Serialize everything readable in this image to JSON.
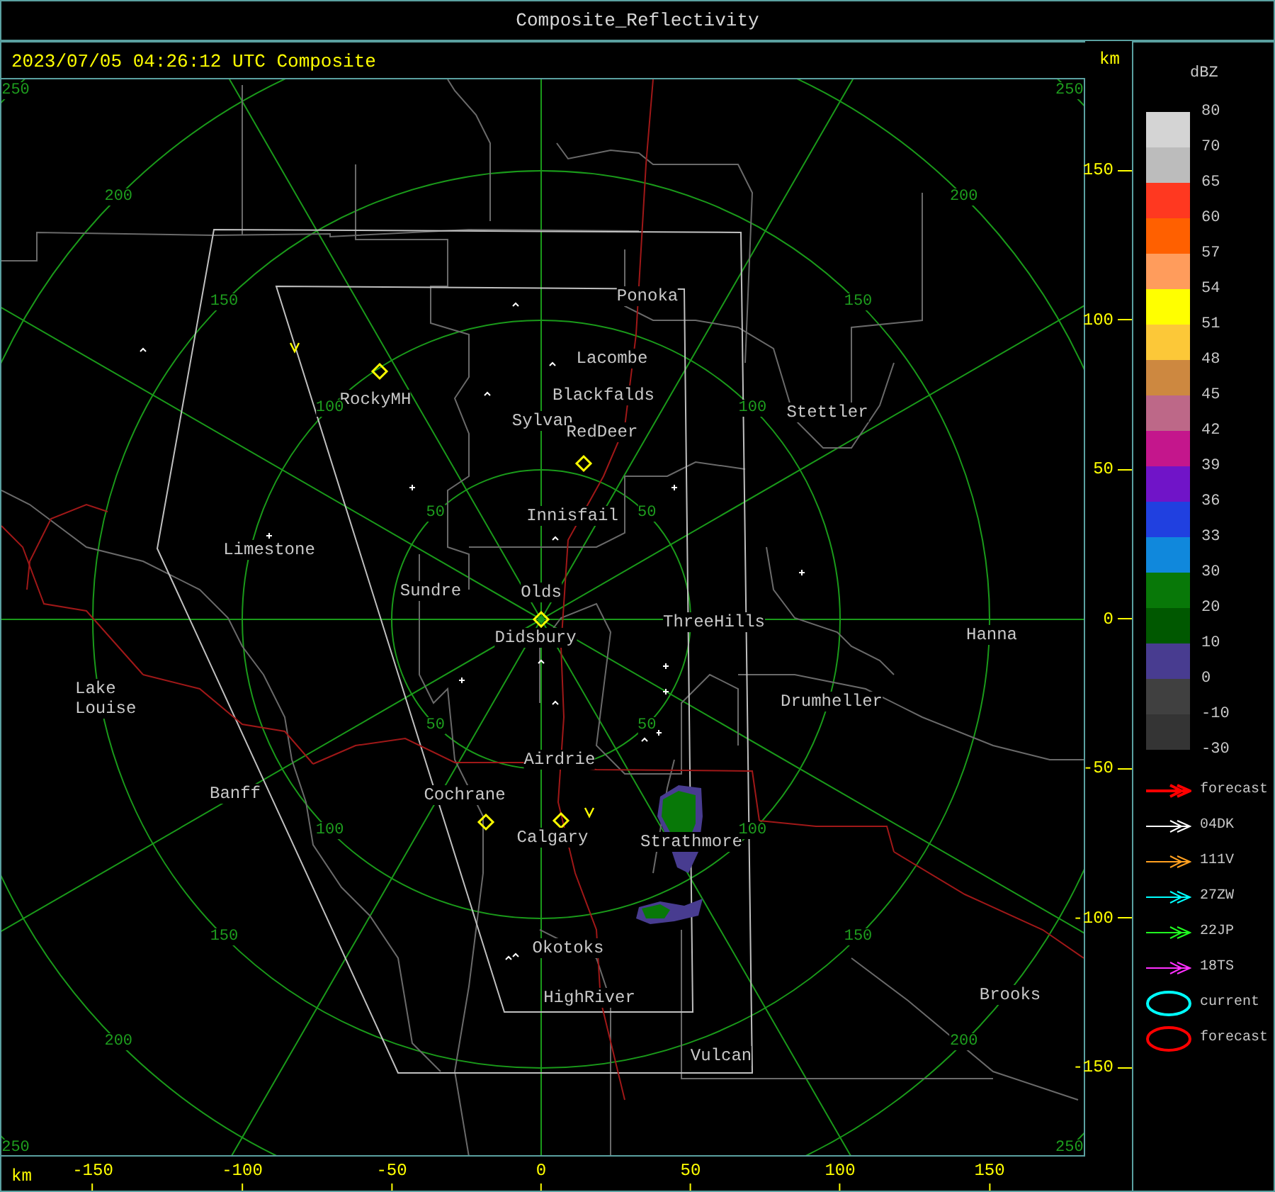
{
  "window": {
    "title": "Composite_Reflectivity"
  },
  "header": {
    "timestamp": "2023/07/05 04:26:12 UTC Composite",
    "y_unit": "km"
  },
  "map": {
    "places": [
      "Ponoka",
      "Lacombe",
      "Blackfalds",
      "Stettler",
      "RockyMH",
      "Sylvan",
      "RedDeer",
      "Innisfail",
      "Limestone",
      "Sundre",
      "Olds",
      "ThreeHills",
      "Hanna",
      "Didsbury",
      "Lake Louise",
      "Drumheller",
      "Airdrie",
      "Banff",
      "Cochrane",
      "Calgary",
      "Strathmore",
      "Okotoks",
      "HighRiver",
      "Brooks",
      "Vulcan"
    ],
    "ring_labels": [
      "50",
      "50",
      "50",
      "50",
      "100",
      "100",
      "100",
      "100",
      "150",
      "150",
      "150",
      "150",
      "200",
      "200",
      "200",
      "200",
      "250",
      "250",
      "250",
      "250"
    ]
  },
  "x_axis": {
    "unit": "km",
    "ticks": [
      "-150",
      "-100",
      "-50",
      "0",
      "50",
      "100",
      "150"
    ]
  },
  "y_axis": {
    "ticks": [
      "150",
      "100",
      "50",
      "0",
      "-50",
      "-100",
      "-150"
    ]
  },
  "color_scale": {
    "unit": "dBZ",
    "labels": [
      "80",
      "70",
      "65",
      "60",
      "57",
      "54",
      "51",
      "48",
      "45",
      "42",
      "39",
      "36",
      "33",
      "30",
      "20",
      "10",
      "0",
      "-10",
      "-30"
    ],
    "bands": [
      {
        "color": "#d4d4d4"
      },
      {
        "color": "#bcbcbc"
      },
      {
        "color": "#ff3820"
      },
      {
        "color": "#ff6000"
      },
      {
        "color": "#ff9c5c"
      },
      {
        "color": "#ffff00"
      },
      {
        "color": "#fcc838"
      },
      {
        "color": "#cd8840"
      },
      {
        "color": "#bd6888"
      },
      {
        "color": "#c4168c"
      },
      {
        "color": "#7014c8"
      },
      {
        "color": "#2040e0"
      },
      {
        "color": "#1088dc"
      },
      {
        "color": "#087808"
      },
      {
        "color": "#005800"
      },
      {
        "color": "#483c90"
      },
      {
        "color": "#404040"
      },
      {
        "color": "#343434"
      }
    ]
  },
  "track_legend": [
    {
      "kind": "arrow",
      "color": "#ff0000",
      "label": "forecast"
    },
    {
      "kind": "arrow",
      "color": "#ffffff",
      "label": "04DK"
    },
    {
      "kind": "arrow",
      "color": "#ffa020",
      "label": "111V"
    },
    {
      "kind": "arrow",
      "color": "#00ffff",
      "label": "27ZW"
    },
    {
      "kind": "arrow",
      "color": "#20ff20",
      "label": "22JP"
    },
    {
      "kind": "arrow",
      "color": "#ff30ff",
      "label": "18TS"
    },
    {
      "kind": "ellipse",
      "color": "#00ffff",
      "label": "current"
    },
    {
      "kind": "ellipse",
      "color": "#ff0000",
      "label": "forecast"
    }
  ]
}
